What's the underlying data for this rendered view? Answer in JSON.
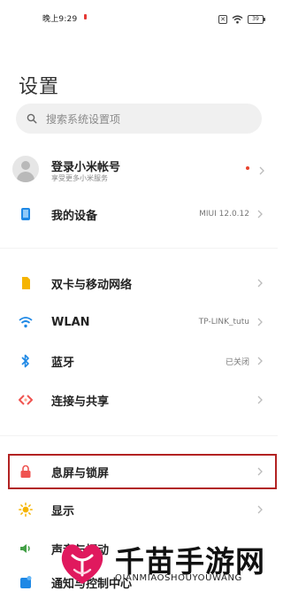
{
  "status_bar": {
    "time": "晚上9:29",
    "sim_icon": "sim-off-icon",
    "wifi_icon": "wifi-icon",
    "battery": "39"
  },
  "title": "设置",
  "search": {
    "placeholder": "搜索系统设置项"
  },
  "account": {
    "title": "登录小米帐号",
    "subtitle": "享受更多小米服务"
  },
  "device": {
    "label": "我的设备",
    "value": "MIUI 12.0.12"
  },
  "items": [
    {
      "label": "双卡与移动网络",
      "value": "",
      "icon": "sim-card-icon",
      "color": "#f5b400"
    },
    {
      "label": "WLAN",
      "value": "TP-LINK_tutu",
      "icon": "wifi-icon",
      "color": "#1e88e5"
    },
    {
      "label": "蓝牙",
      "value": "已关闭",
      "icon": "bluetooth-icon",
      "color": "#1e88e5"
    },
    {
      "label": "连接与共享",
      "value": "",
      "icon": "share-icon",
      "color": "#ef5350"
    },
    {
      "label": "息屏与锁屏",
      "value": "",
      "icon": "lock-icon",
      "color": "#ef5350"
    },
    {
      "label": "显示",
      "value": "",
      "icon": "sun-icon",
      "color": "#f5b400"
    },
    {
      "label": "声音与振动",
      "value": "",
      "icon": "speaker-icon",
      "color": "#43a047"
    },
    {
      "label": "通知与控制中心",
      "value": "",
      "icon": "notification-icon",
      "color": "#1e88e5"
    }
  ],
  "watermark": {
    "title": "千苗手游网",
    "subtitle": "QIANMIAOSHOUYOUWANG"
  },
  "colors": {
    "highlight_border": "#b22222",
    "search_bg": "#f0f0f0"
  }
}
